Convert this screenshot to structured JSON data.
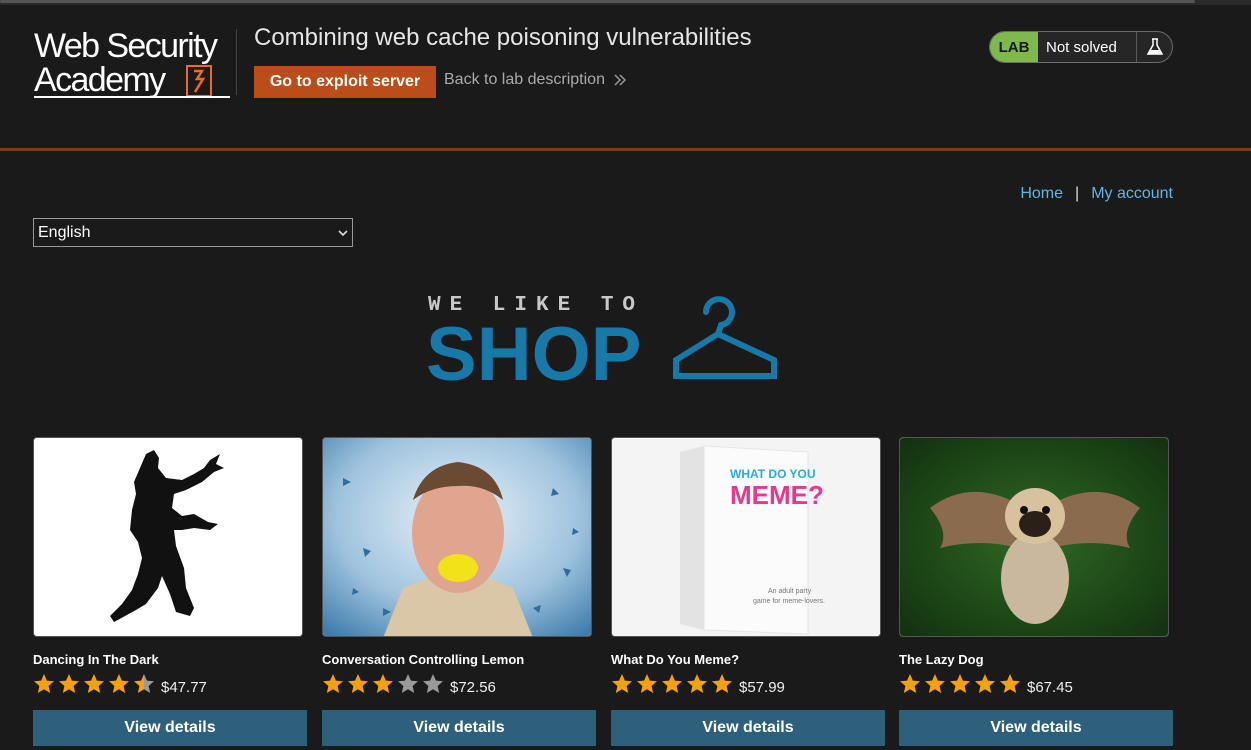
{
  "header": {
    "logo_line1": "Web Security",
    "logo_line2": "Academy",
    "lab_title": "Combining web cache poisoning vulnerabilities",
    "exploit_button": "Go to exploit server",
    "back_link": "Back to lab description",
    "status": {
      "badge": "LAB",
      "state": "Not solved"
    }
  },
  "nav": {
    "home": "Home",
    "separator": "|",
    "my_account": "My account"
  },
  "language": {
    "selected": "English"
  },
  "banner": {
    "top_text": "WE LIKE TO",
    "main_text": "SHOP"
  },
  "products": [
    {
      "name": "Dancing In The Dark",
      "rating": 4.5,
      "price": "$47.77",
      "button": "View details"
    },
    {
      "name": "Conversation Controlling Lemon",
      "rating": 3,
      "price": "$72.56",
      "button": "View details"
    },
    {
      "name": "What Do You Meme?",
      "rating": 5,
      "price": "$57.99",
      "button": "View details"
    },
    {
      "name": "The Lazy Dog",
      "rating": 5,
      "price": "$67.45",
      "button": "View details"
    }
  ],
  "meme_box": {
    "line1": "WHAT DO YOU",
    "line2": "MEME?",
    "caption1": "An adult party",
    "caption2": "game for meme-lovers."
  },
  "colors": {
    "accent_orange": "#b94e1b",
    "button_blue": "#2e5f7b",
    "link_blue": "#5fb6e8",
    "lab_green": "#7fb94e",
    "star_gold": "#f2a10f"
  }
}
